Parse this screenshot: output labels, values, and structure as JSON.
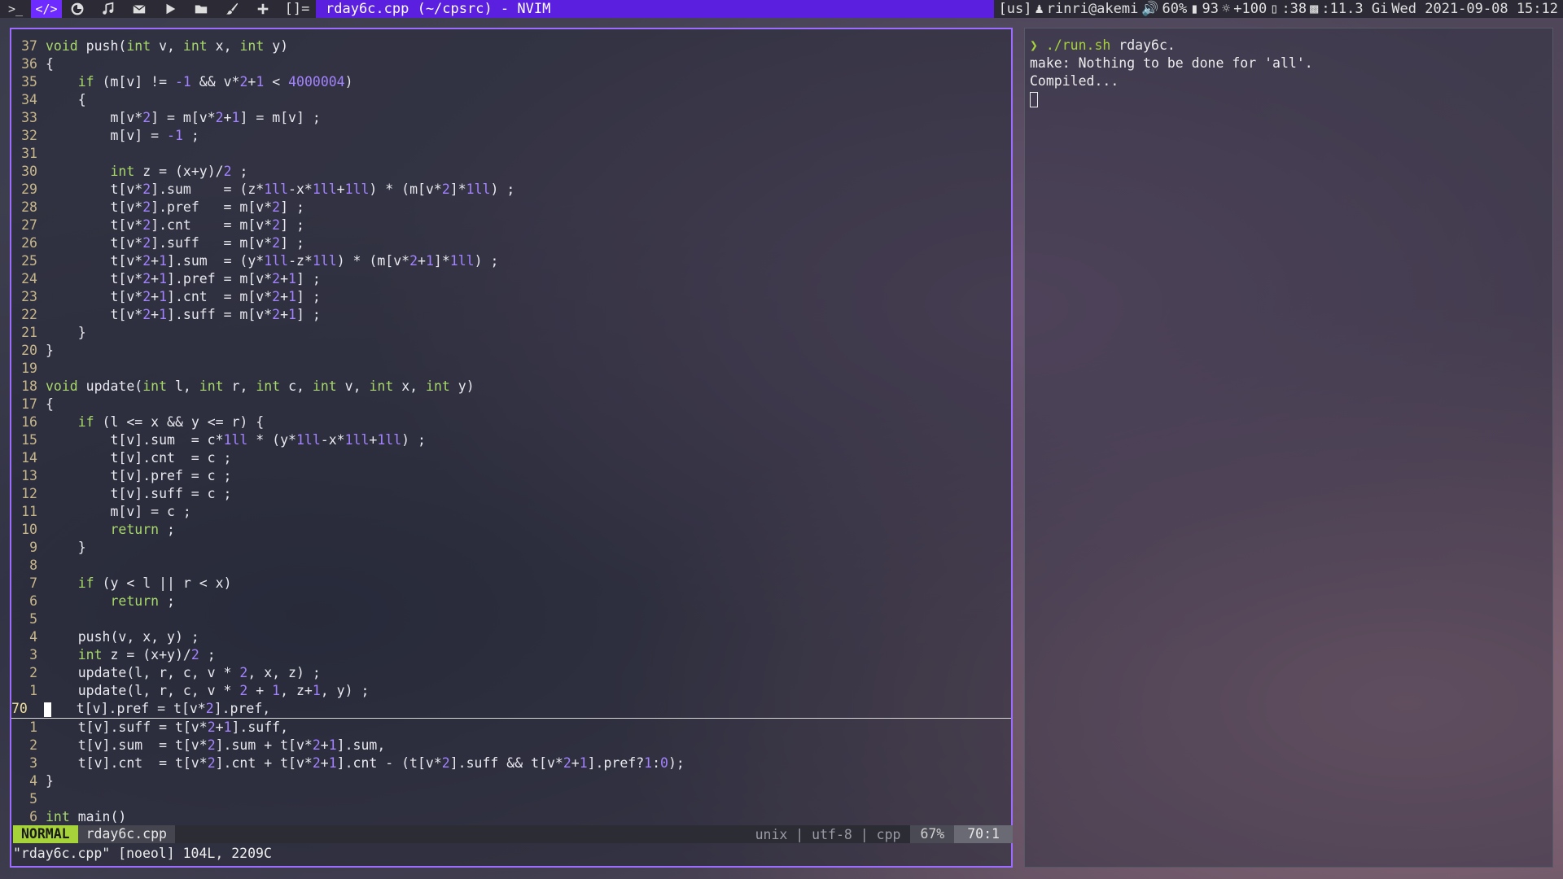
{
  "topbar": {
    "workspaces": [
      {
        "icon": "terminal-icon",
        "label": ">_"
      },
      {
        "icon": "code-icon",
        "label": "</>"
      },
      {
        "icon": "firefox-icon",
        "label": ""
      },
      {
        "icon": "music-icon",
        "label": ""
      },
      {
        "icon": "mail-icon",
        "label": ""
      },
      {
        "icon": "play-icon",
        "label": ""
      },
      {
        "icon": "folder-icon",
        "label": ""
      },
      {
        "icon": "brush-icon",
        "label": ""
      },
      {
        "icon": "plus-icon",
        "label": ""
      }
    ],
    "layout": "[]=",
    "window_title": "rday6c.cpp (~/cpsrc) - NVIM",
    "keyboard": "[us]",
    "user": "rinri@akemi",
    "volume": "60%",
    "battery": "93",
    "brightness": "+100",
    "disk": ":38",
    "memory": ":11.3 Gi",
    "datetime": "Wed 2021-09-08 15:12"
  },
  "editor": {
    "lines": [
      {
        "n": "37",
        "tokens": [
          [
            "kw",
            "void"
          ],
          [
            "txt",
            " push("
          ],
          [
            "kw",
            "int"
          ],
          [
            "txt",
            " v, "
          ],
          [
            "kw",
            "int"
          ],
          [
            "txt",
            " x, "
          ],
          [
            "kw",
            "int"
          ],
          [
            "txt",
            " y)"
          ]
        ]
      },
      {
        "n": "36",
        "tokens": [
          [
            "txt",
            "{"
          ]
        ]
      },
      {
        "n": "35",
        "tokens": [
          [
            "txt",
            "    "
          ],
          [
            "kw",
            "if"
          ],
          [
            "txt",
            " (m[v] != "
          ],
          [
            "num",
            "-1"
          ],
          [
            "txt",
            " && v*"
          ],
          [
            "num",
            "2"
          ],
          [
            "txt",
            "+"
          ],
          [
            "num",
            "1"
          ],
          [
            "txt",
            " < "
          ],
          [
            "num",
            "4000004"
          ],
          [
            "txt",
            ")"
          ]
        ]
      },
      {
        "n": "34",
        "tokens": [
          [
            "txt",
            "    {"
          ]
        ]
      },
      {
        "n": "33",
        "tokens": [
          [
            "txt",
            "        m[v*"
          ],
          [
            "num",
            "2"
          ],
          [
            "txt",
            "] = m[v*"
          ],
          [
            "num",
            "2"
          ],
          [
            "txt",
            "+"
          ],
          [
            "num",
            "1"
          ],
          [
            "txt",
            "] = m[v] ;"
          ]
        ]
      },
      {
        "n": "32",
        "tokens": [
          [
            "txt",
            "        m[v] = "
          ],
          [
            "num",
            "-1"
          ],
          [
            "txt",
            " ;"
          ]
        ]
      },
      {
        "n": "31",
        "tokens": []
      },
      {
        "n": "30",
        "tokens": [
          [
            "txt",
            "        "
          ],
          [
            "kw",
            "int"
          ],
          [
            "txt",
            " z = (x+y)/"
          ],
          [
            "num",
            "2"
          ],
          [
            "txt",
            " ;"
          ]
        ]
      },
      {
        "n": "29",
        "tokens": [
          [
            "txt",
            "        t[v*"
          ],
          [
            "num",
            "2"
          ],
          [
            "txt",
            "].sum    = (z*"
          ],
          [
            "num",
            "1ll"
          ],
          [
            "txt",
            "-x*"
          ],
          [
            "num",
            "1ll"
          ],
          [
            "txt",
            "+"
          ],
          [
            "num",
            "1ll"
          ],
          [
            "txt",
            ") * (m[v*"
          ],
          [
            "num",
            "2"
          ],
          [
            "txt",
            "]*"
          ],
          [
            "num",
            "1ll"
          ],
          [
            "txt",
            ") ;"
          ]
        ]
      },
      {
        "n": "28",
        "tokens": [
          [
            "txt",
            "        t[v*"
          ],
          [
            "num",
            "2"
          ],
          [
            "txt",
            "].pref   = m[v*"
          ],
          [
            "num",
            "2"
          ],
          [
            "txt",
            "] ;"
          ]
        ]
      },
      {
        "n": "27",
        "tokens": [
          [
            "txt",
            "        t[v*"
          ],
          [
            "num",
            "2"
          ],
          [
            "txt",
            "].cnt    = m[v*"
          ],
          [
            "num",
            "2"
          ],
          [
            "txt",
            "] ;"
          ]
        ]
      },
      {
        "n": "26",
        "tokens": [
          [
            "txt",
            "        t[v*"
          ],
          [
            "num",
            "2"
          ],
          [
            "txt",
            "].suff   = m[v*"
          ],
          [
            "num",
            "2"
          ],
          [
            "txt",
            "] ;"
          ]
        ]
      },
      {
        "n": "25",
        "tokens": [
          [
            "txt",
            "        t[v*"
          ],
          [
            "num",
            "2"
          ],
          [
            "txt",
            "+"
          ],
          [
            "num",
            "1"
          ],
          [
            "txt",
            "].sum  = (y*"
          ],
          [
            "num",
            "1ll"
          ],
          [
            "txt",
            "-z*"
          ],
          [
            "num",
            "1ll"
          ],
          [
            "txt",
            ") * (m[v*"
          ],
          [
            "num",
            "2"
          ],
          [
            "txt",
            "+"
          ],
          [
            "num",
            "1"
          ],
          [
            "txt",
            "]*"
          ],
          [
            "num",
            "1ll"
          ],
          [
            "txt",
            ") ;"
          ]
        ]
      },
      {
        "n": "24",
        "tokens": [
          [
            "txt",
            "        t[v*"
          ],
          [
            "num",
            "2"
          ],
          [
            "txt",
            "+"
          ],
          [
            "num",
            "1"
          ],
          [
            "txt",
            "].pref = m[v*"
          ],
          [
            "num",
            "2"
          ],
          [
            "txt",
            "+"
          ],
          [
            "num",
            "1"
          ],
          [
            "txt",
            "] ;"
          ]
        ]
      },
      {
        "n": "23",
        "tokens": [
          [
            "txt",
            "        t[v*"
          ],
          [
            "num",
            "2"
          ],
          [
            "txt",
            "+"
          ],
          [
            "num",
            "1"
          ],
          [
            "txt",
            "].cnt  = m[v*"
          ],
          [
            "num",
            "2"
          ],
          [
            "txt",
            "+"
          ],
          [
            "num",
            "1"
          ],
          [
            "txt",
            "] ;"
          ]
        ]
      },
      {
        "n": "22",
        "tokens": [
          [
            "txt",
            "        t[v*"
          ],
          [
            "num",
            "2"
          ],
          [
            "txt",
            "+"
          ],
          [
            "num",
            "1"
          ],
          [
            "txt",
            "].suff = m[v*"
          ],
          [
            "num",
            "2"
          ],
          [
            "txt",
            "+"
          ],
          [
            "num",
            "1"
          ],
          [
            "txt",
            "] ;"
          ]
        ]
      },
      {
        "n": "21",
        "tokens": [
          [
            "txt",
            "    }"
          ]
        ]
      },
      {
        "n": "20",
        "tokens": [
          [
            "txt",
            "}"
          ]
        ]
      },
      {
        "n": "19",
        "tokens": []
      },
      {
        "n": "18",
        "tokens": [
          [
            "kw",
            "void"
          ],
          [
            "txt",
            " update("
          ],
          [
            "kw",
            "int"
          ],
          [
            "txt",
            " l, "
          ],
          [
            "kw",
            "int"
          ],
          [
            "txt",
            " r, "
          ],
          [
            "kw",
            "int"
          ],
          [
            "txt",
            " c, "
          ],
          [
            "kw",
            "int"
          ],
          [
            "txt",
            " v, "
          ],
          [
            "kw",
            "int"
          ],
          [
            "txt",
            " x, "
          ],
          [
            "kw",
            "int"
          ],
          [
            "txt",
            " y)"
          ]
        ]
      },
      {
        "n": "17",
        "tokens": [
          [
            "txt",
            "{"
          ]
        ]
      },
      {
        "n": "16",
        "tokens": [
          [
            "txt",
            "    "
          ],
          [
            "kw",
            "if"
          ],
          [
            "txt",
            " (l <= x && y <= r) {"
          ]
        ]
      },
      {
        "n": "15",
        "tokens": [
          [
            "txt",
            "        t[v].sum  = c*"
          ],
          [
            "num",
            "1ll"
          ],
          [
            "txt",
            " * (y*"
          ],
          [
            "num",
            "1ll"
          ],
          [
            "txt",
            "-x*"
          ],
          [
            "num",
            "1ll"
          ],
          [
            "txt",
            "+"
          ],
          [
            "num",
            "1ll"
          ],
          [
            "txt",
            ") ;"
          ]
        ]
      },
      {
        "n": "14",
        "tokens": [
          [
            "txt",
            "        t[v].cnt  = c ;"
          ]
        ]
      },
      {
        "n": "13",
        "tokens": [
          [
            "txt",
            "        t[v].pref = c ;"
          ]
        ]
      },
      {
        "n": "12",
        "tokens": [
          [
            "txt",
            "        t[v].suff = c ;"
          ]
        ]
      },
      {
        "n": "11",
        "tokens": [
          [
            "txt",
            "        m[v] = c ;"
          ]
        ]
      },
      {
        "n": "10",
        "tokens": [
          [
            "txt",
            "        "
          ],
          [
            "kw",
            "return"
          ],
          [
            "txt",
            " ;"
          ]
        ]
      },
      {
        "n": "9",
        "tokens": [
          [
            "txt",
            "    }"
          ]
        ]
      },
      {
        "n": "8",
        "tokens": []
      },
      {
        "n": "7",
        "tokens": [
          [
            "txt",
            "    "
          ],
          [
            "kw",
            "if"
          ],
          [
            "txt",
            " (y < l || r < x)"
          ]
        ]
      },
      {
        "n": "6",
        "tokens": [
          [
            "txt",
            "        "
          ],
          [
            "kw",
            "return"
          ],
          [
            "txt",
            " ;"
          ]
        ]
      },
      {
        "n": "5",
        "tokens": []
      },
      {
        "n": "4",
        "tokens": [
          [
            "txt",
            "    push(v, x, y) ;"
          ]
        ]
      },
      {
        "n": "3",
        "tokens": [
          [
            "txt",
            "    "
          ],
          [
            "kw",
            "int"
          ],
          [
            "txt",
            " z = (x+y)/"
          ],
          [
            "num",
            "2"
          ],
          [
            "txt",
            " ;"
          ]
        ]
      },
      {
        "n": "2",
        "tokens": [
          [
            "txt",
            "    update(l, r, c, v * "
          ],
          [
            "num",
            "2"
          ],
          [
            "txt",
            ", x, z) ;"
          ]
        ]
      },
      {
        "n": "1",
        "tokens": [
          [
            "txt",
            "    update(l, r, c, v * "
          ],
          [
            "num",
            "2"
          ],
          [
            "txt",
            " + "
          ],
          [
            "num",
            "1"
          ],
          [
            "txt",
            ", z+"
          ],
          [
            "num",
            "1"
          ],
          [
            "txt",
            ", y) ;"
          ]
        ]
      },
      {
        "n": "70",
        "current": true,
        "tokens": [
          [
            "txt",
            "   t[v].pref = t[v*"
          ],
          [
            "num",
            "2"
          ],
          [
            "txt",
            "].pref,"
          ]
        ]
      },
      {
        "n": "1",
        "tokens": [
          [
            "txt",
            "    t[v].suff = t[v*"
          ],
          [
            "num",
            "2"
          ],
          [
            "txt",
            "+"
          ],
          [
            "num",
            "1"
          ],
          [
            "txt",
            "].suff,"
          ]
        ]
      },
      {
        "n": "2",
        "tokens": [
          [
            "txt",
            "    t[v].sum  = t[v*"
          ],
          [
            "num",
            "2"
          ],
          [
            "txt",
            "].sum + t[v*"
          ],
          [
            "num",
            "2"
          ],
          [
            "txt",
            "+"
          ],
          [
            "num",
            "1"
          ],
          [
            "txt",
            "].sum,"
          ]
        ]
      },
      {
        "n": "3",
        "tokens": [
          [
            "txt",
            "    t[v].cnt  = t[v*"
          ],
          [
            "num",
            "2"
          ],
          [
            "txt",
            "].cnt + t[v*"
          ],
          [
            "num",
            "2"
          ],
          [
            "txt",
            "+"
          ],
          [
            "num",
            "1"
          ],
          [
            "txt",
            "].cnt - (t[v*"
          ],
          [
            "num",
            "2"
          ],
          [
            "txt",
            "].suff && t[v*"
          ],
          [
            "num",
            "2"
          ],
          [
            "txt",
            "+"
          ],
          [
            "num",
            "1"
          ],
          [
            "txt",
            "].pref?"
          ],
          [
            "num",
            "1"
          ],
          [
            "txt",
            ":"
          ],
          [
            "num",
            "0"
          ],
          [
            "txt",
            ");"
          ]
        ]
      },
      {
        "n": "4",
        "tokens": [
          [
            "txt",
            "}"
          ]
        ]
      },
      {
        "n": "5",
        "tokens": []
      },
      {
        "n": "6",
        "tokens": [
          [
            "kw",
            "int"
          ],
          [
            "txt",
            " main()"
          ]
        ]
      }
    ],
    "statusline": {
      "mode": "NORMAL",
      "filename": "rday6c.cpp",
      "fileinfo": "unix | utf-8 | cpp",
      "percent": "67%",
      "position": "70:1"
    },
    "message": "\"rday6c.cpp\" [noeol] 104L, 2209C"
  },
  "terminal": {
    "prompt": "❯",
    "command": " ./run.sh",
    "argument": " rday6c.",
    "output": [
      "make: Nothing to be done for 'all'.",
      "Compiled..."
    ]
  },
  "colors": {
    "accent": "#5b1fe0",
    "keyword": "#a8d86a",
    "number": "#a383ff",
    "mode_bg": "#a6d23a",
    "border": "#9c6bff"
  }
}
